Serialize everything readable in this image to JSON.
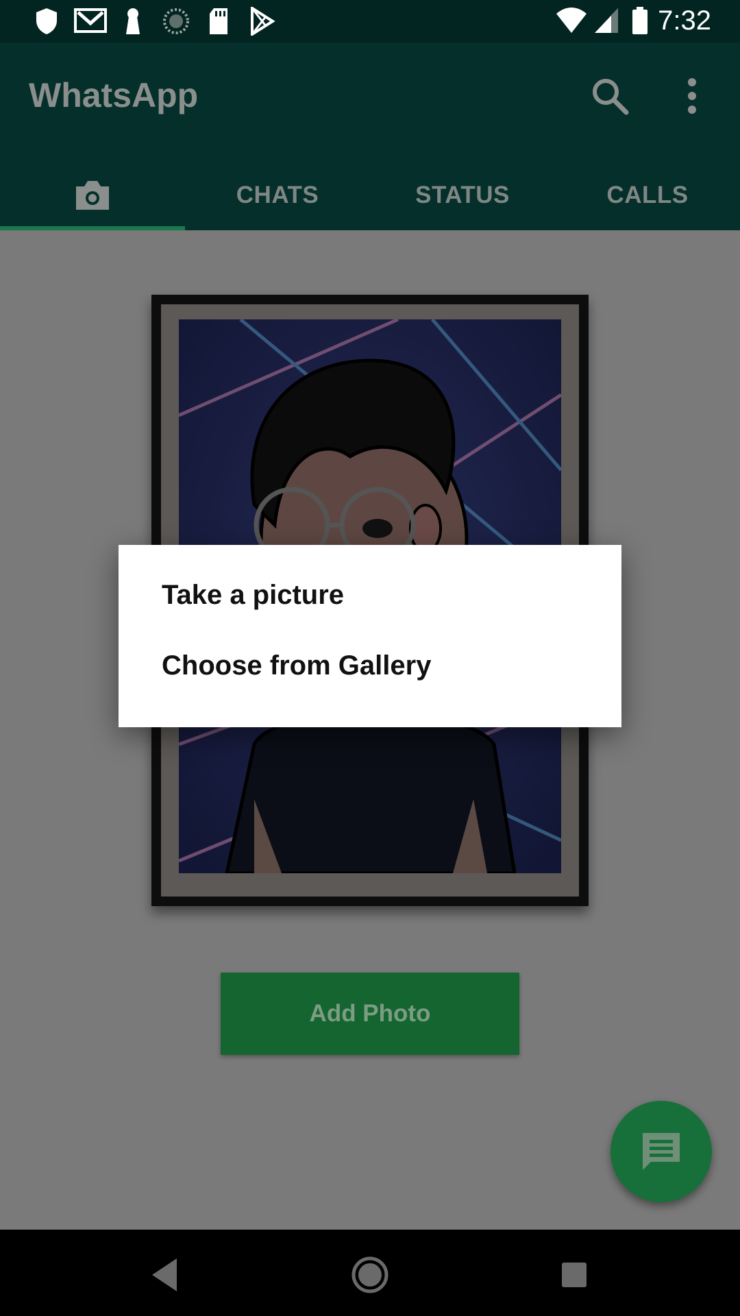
{
  "status_bar": {
    "time": "7:32",
    "left_icons": [
      "shield-icon",
      "gmail-icon",
      "keyhole-icon",
      "sync-icon",
      "sd-card-icon",
      "play-store-icon"
    ],
    "right_icons": [
      "wifi-icon",
      "cell-signal-icon",
      "battery-icon"
    ]
  },
  "app_bar": {
    "title": "WhatsApp",
    "actions": [
      "search-icon",
      "more-vert-icon"
    ]
  },
  "tabs": [
    {
      "label": "",
      "icon": "camera-icon",
      "selected": true
    },
    {
      "label": "CHATS",
      "selected": false
    },
    {
      "label": "STATUS",
      "selected": false
    },
    {
      "label": "CALLS",
      "selected": false
    }
  ],
  "content": {
    "add_photo_label": "Add Photo",
    "fab_icon": "chat-icon"
  },
  "dialog": {
    "items": [
      {
        "label": "Take a picture"
      },
      {
        "label": "Choose from Gallery"
      }
    ]
  },
  "nav_bar": {
    "buttons": [
      "back-icon",
      "home-icon",
      "recents-icon"
    ]
  },
  "colors": {
    "app_bar": "#052f2a",
    "accent_green": "#156531",
    "tab_indicator": "#1a7a4d",
    "scrim_background": "#7a7a7a"
  }
}
